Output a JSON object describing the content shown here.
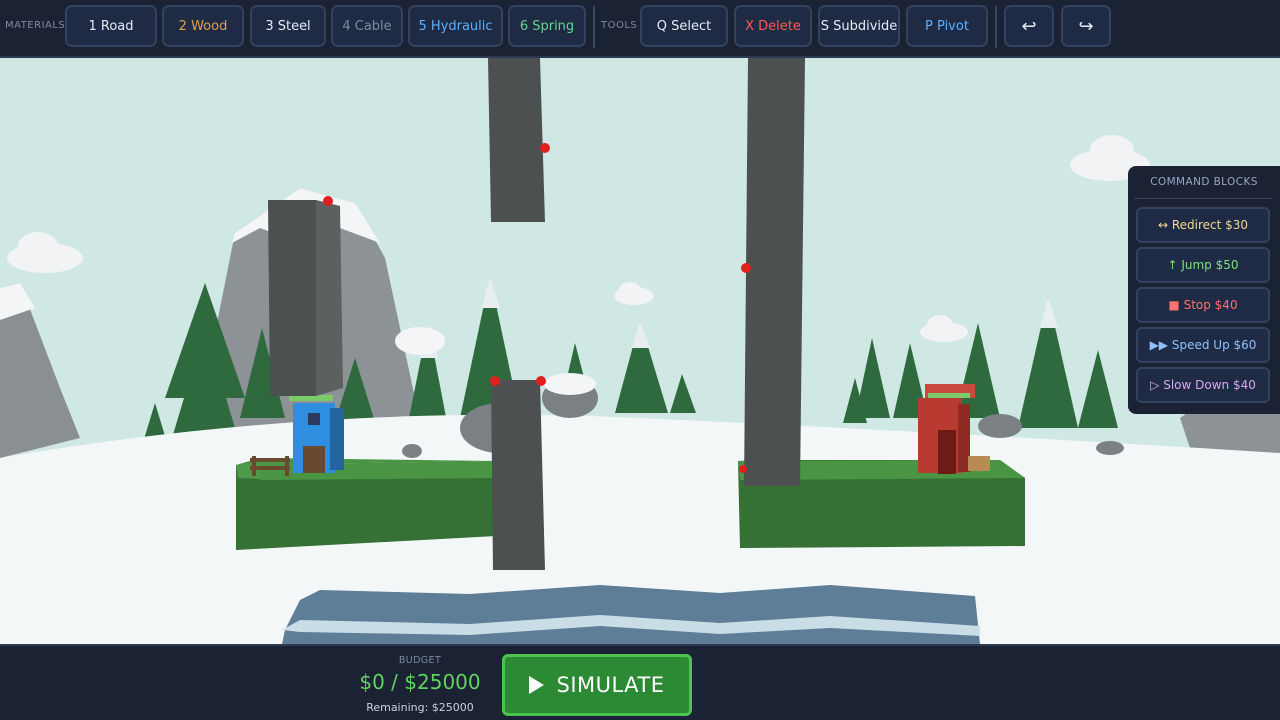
{
  "toolbar": {
    "materials_label": "MATERIALS",
    "tools_label": "TOOLS",
    "materials": [
      {
        "label": "1 Road",
        "color": "#e6ebf5"
      },
      {
        "label": "2 Wood",
        "color": "#e0a050"
      },
      {
        "label": "3 Steel",
        "color": "#e6ebf5"
      },
      {
        "label": "4 Cable",
        "color": "#808a9e"
      },
      {
        "label": "5 Hydraulic",
        "color": "#5ab0ff"
      },
      {
        "label": "6 Spring",
        "color": "#65d88e"
      }
    ],
    "tools": [
      {
        "label": "Q Select",
        "color": "#e6ebf5"
      },
      {
        "label": "X Delete",
        "color": "#ff5a50"
      },
      {
        "label": "S Subdivide",
        "color": "#e6ebf5"
      },
      {
        "label": "P Pivot",
        "color": "#5ab0ff"
      }
    ],
    "undo_glyph": "↩",
    "redo_glyph": "↪"
  },
  "command_blocks": {
    "title": "COMMAND BLOCKS",
    "items": [
      {
        "label": "↔ Redirect $30",
        "color": "#f0d890",
        "icon": "redirect-icon"
      },
      {
        "label": "↑ Jump $50",
        "color": "#7ee07e",
        "icon": "jump-icon"
      },
      {
        "label": "■ Stop $40",
        "color": "#ff7070",
        "icon": "stop-icon"
      },
      {
        "label": "▶▶ Speed Up $60",
        "color": "#8ec0ff",
        "icon": "speed-up-icon"
      },
      {
        "label": "▷ Slow Down $40",
        "color": "#d8a8f0",
        "icon": "slow-down-icon"
      }
    ]
  },
  "budget": {
    "label": "BUDGET",
    "value": "$0 / $25000",
    "remaining": "Remaining: $25000"
  },
  "simulate": {
    "label": "SIMULATE",
    "color": "#2b8a33"
  },
  "scene": {
    "sky_color": "#cfe8e4",
    "snow_color": "#f4f7f8",
    "grass_color": "#3d7a3d",
    "pillar_color": "#4d5050",
    "anchor_color": "#e21f1f",
    "water_color": "#5d7e96",
    "blue_house_color": "#2f8ee0",
    "red_house_color": "#b83a30"
  }
}
